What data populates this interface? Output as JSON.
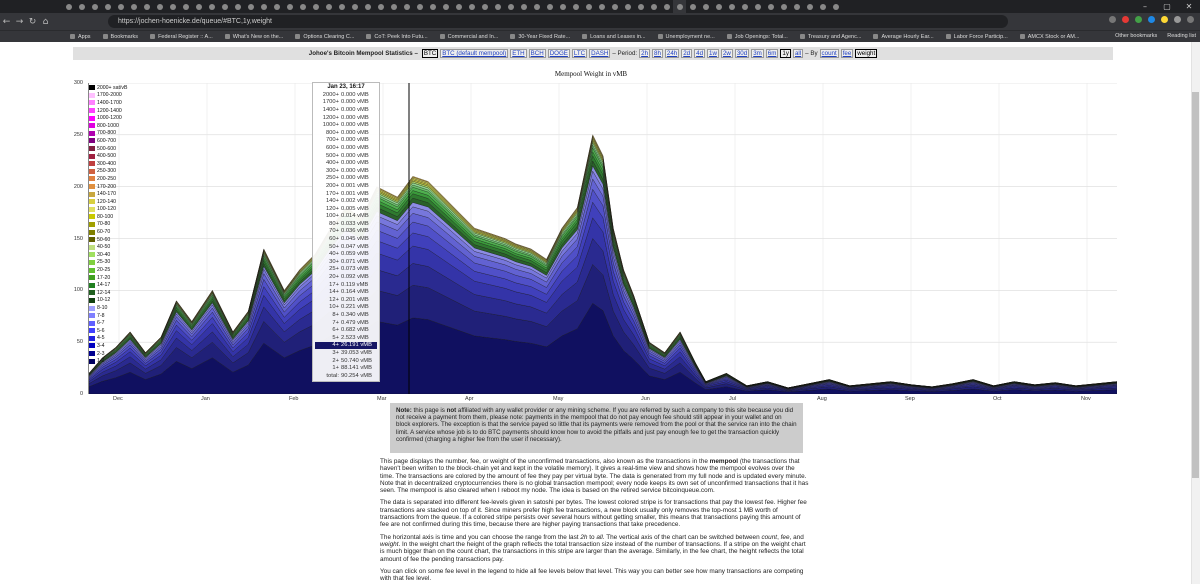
{
  "browser": {
    "url": "https://jochen-hoenicke.de/queue/#BTC,1y,weight",
    "window_controls": [
      "–",
      "▢",
      "✕"
    ],
    "tab_count": 60,
    "bookmarks": [
      {
        "label": "Apps"
      },
      {
        "label": "Bookmarks"
      },
      {
        "label": "Federal Register :: A..."
      },
      {
        "label": "What's New on the..."
      },
      {
        "label": "Options Clearing C..."
      },
      {
        "label": "CoT: Peek Into Futu..."
      },
      {
        "label": "Commercial and In..."
      },
      {
        "label": "30-Year Fixed Rate..."
      },
      {
        "label": "Loans and Leases in..."
      },
      {
        "label": "Unemployment ne..."
      },
      {
        "label": "Job Openings: Total..."
      },
      {
        "label": "Treasury and Agenc..."
      },
      {
        "label": "Average Hourly Ear..."
      },
      {
        "label": "Labor Force Particip..."
      },
      {
        "label": "AMCX Stock or AM..."
      }
    ],
    "bookmarks_right": [
      "Other bookmarks",
      "Reading list"
    ]
  },
  "header": {
    "title": "Johoe's Bitcoin Mempool Statistics –",
    "currencies": [
      {
        "label": "BTC",
        "selected": true
      },
      {
        "label": "BTC (default mempool)",
        "selected": false
      },
      {
        "label": "ETH",
        "selected": false
      },
      {
        "label": "BCH",
        "selected": false
      },
      {
        "label": "DOGE",
        "selected": false
      },
      {
        "label": "LTC",
        "selected": false
      },
      {
        "label": "DASH",
        "selected": false
      }
    ],
    "period_label": "– Period:",
    "periods": [
      {
        "label": "2h",
        "selected": false
      },
      {
        "label": "8h",
        "selected": false
      },
      {
        "label": "24h",
        "selected": false
      },
      {
        "label": "2d",
        "selected": false
      },
      {
        "label": "4d",
        "selected": false
      },
      {
        "label": "1w",
        "selected": false
      },
      {
        "label": "2w",
        "selected": false
      },
      {
        "label": "30d",
        "selected": false
      },
      {
        "label": "3m",
        "selected": false
      },
      {
        "label": "6m",
        "selected": false
      },
      {
        "label": "1y",
        "selected": true
      },
      {
        "label": "all",
        "selected": false
      }
    ],
    "by_label": "– By",
    "modes": [
      {
        "label": "count",
        "selected": false
      },
      {
        "label": "fee",
        "selected": false
      },
      {
        "label": "weight",
        "selected": true
      }
    ]
  },
  "chart_data": {
    "type": "area",
    "title": "Mempool Weight in vMB",
    "ylim": [
      0,
      300
    ],
    "yticks": [
      0,
      50,
      100,
      150,
      200,
      250,
      300
    ],
    "xticks": [
      "Dec",
      "Jan",
      "Feb",
      "Mar",
      "Apr",
      "May",
      "Jun",
      "Jul",
      "Aug",
      "Sep",
      "Oct",
      "Nov"
    ],
    "grid": true,
    "legend_position": "top-left",
    "series_order_bottom_to_top": [
      "1-2",
      "2-3",
      "3-4",
      "4-5",
      "5-6",
      "6-7",
      "7-8",
      "8-10",
      "10-12",
      "12-14",
      "14-17",
      "17-20",
      "20-25",
      "25-30",
      "30-40",
      "40-50",
      "50-60",
      "60-70",
      "70-80",
      "80-100",
      "100-120",
      "120-140",
      "140-170",
      "170-200",
      "200-250",
      "250-300",
      "300-400",
      "400-500",
      "500-600",
      "600-700",
      "700-800",
      "800-1000",
      "1000-1200",
      "1200-1400",
      "1400-1700",
      "1700-2000",
      "2000+ sat/vB"
    ],
    "legend": [
      {
        "label": "2000+ sat/vB",
        "color": "#000000"
      },
      {
        "label": "1700-2000",
        "color": "#ffc0ff"
      },
      {
        "label": "1400-1700",
        "color": "#ff80ff"
      },
      {
        "label": "1200-1400",
        "color": "#ff40ff"
      },
      {
        "label": "1000-1200",
        "color": "#ff00ff"
      },
      {
        "label": "800-1000",
        "color": "#e000e0"
      },
      {
        "label": "700-800",
        "color": "#b000b0"
      },
      {
        "label": "600-700",
        "color": "#800080"
      },
      {
        "label": "500-600",
        "color": "#802040"
      },
      {
        "label": "400-500",
        "color": "#a02040"
      },
      {
        "label": "300-400",
        "color": "#c04040"
      },
      {
        "label": "250-300",
        "color": "#d06040"
      },
      {
        "label": "200-250",
        "color": "#e08040"
      },
      {
        "label": "170-200",
        "color": "#e09040"
      },
      {
        "label": "140-170",
        "color": "#c8a840"
      },
      {
        "label": "120-140",
        "color": "#d8d040"
      },
      {
        "label": "100-120",
        "color": "#e0e060"
      },
      {
        "label": "80-100",
        "color": "#c8c800"
      },
      {
        "label": "70-80",
        "color": "#a0a000"
      },
      {
        "label": "60-70",
        "color": "#808000"
      },
      {
        "label": "50-60",
        "color": "#606000"
      },
      {
        "label": "40-50",
        "color": "#c0e080"
      },
      {
        "label": "30-40",
        "color": "#a0e060"
      },
      {
        "label": "25-30",
        "color": "#80d040"
      },
      {
        "label": "20-25",
        "color": "#60c030"
      },
      {
        "label": "17-20",
        "color": "#40a020"
      },
      {
        "label": "14-17",
        "color": "#208020"
      },
      {
        "label": "12-14",
        "color": "#206020"
      },
      {
        "label": "10-12",
        "color": "#104010"
      },
      {
        "label": "8-10",
        "color": "#a0a0ff"
      },
      {
        "label": "7-8",
        "color": "#8080ff"
      },
      {
        "label": "6-7",
        "color": "#6060ff"
      },
      {
        "label": "5-6",
        "color": "#4040ff"
      },
      {
        "label": "4-5",
        "color": "#2020e0"
      },
      {
        "label": "3-4",
        "color": "#0000c0"
      },
      {
        "label": "2-3",
        "color": "#000090"
      },
      {
        "label": "1-2",
        "color": "#000060"
      }
    ],
    "series_palette": [
      "#101060",
      "#202078",
      "#2a2a90",
      "#3434a8",
      "#4040bb",
      "#5050c8",
      "#6262d2",
      "#7777dc",
      "#8c8ce4",
      "#2a602a",
      "#2f7a2f",
      "#3a9a3a",
      "#4fb04f",
      "#6cc46c",
      "#8fd48f",
      "#a8d060",
      "#c0c040",
      "#d8d850",
      "#e8e070",
      "#d8b040"
    ],
    "series_x": [
      0.0,
      0.013,
      0.026,
      0.04,
      0.055,
      0.07,
      0.085,
      0.1,
      0.12,
      0.14,
      0.155,
      0.17,
      0.19,
      0.205,
      0.22,
      0.235,
      0.25,
      0.265,
      0.28,
      0.3,
      0.315,
      0.33,
      0.345,
      0.36,
      0.375,
      0.39,
      0.405,
      0.415,
      0.43,
      0.445,
      0.46,
      0.475,
      0.49,
      0.5,
      0.51,
      0.52,
      0.53,
      0.545,
      0.56,
      0.575,
      0.59,
      0.6,
      0.62,
      0.64,
      0.66,
      0.68,
      0.7,
      0.72,
      0.74,
      0.76,
      0.78,
      0.8,
      0.82,
      0.84,
      0.86,
      0.88,
      0.9,
      0.92,
      0.94,
      0.96,
      0.98,
      1.0
    ],
    "series_total_vmb": [
      20,
      35,
      45,
      60,
      40,
      55,
      90,
      70,
      100,
      60,
      80,
      140,
      100,
      120,
      135,
      160,
      180,
      170,
      200,
      190,
      210,
      205,
      190,
      175,
      160,
      155,
      150,
      145,
      140,
      130,
      160,
      180,
      250,
      230,
      160,
      120,
      95,
      50,
      40,
      60,
      30,
      12,
      20,
      8,
      12,
      6,
      10,
      14,
      8,
      10,
      12,
      9,
      7,
      10,
      14,
      8,
      12,
      9,
      11,
      8,
      10,
      12
    ],
    "tooltip": {
      "date": "Jan 23, 16:17",
      "selected": "4+",
      "rows": [
        {
          "k": "2000+",
          "v": "0.000 vMB"
        },
        {
          "k": "1700+",
          "v": "0.000 vMB"
        },
        {
          "k": "1400+",
          "v": "0.000 vMB"
        },
        {
          "k": "1200+",
          "v": "0.000 vMB"
        },
        {
          "k": "1000+",
          "v": "0.000 vMB"
        },
        {
          "k": "800+",
          "v": "0.000 vMB"
        },
        {
          "k": "700+",
          "v": "0.000 vMB"
        },
        {
          "k": "600+",
          "v": "0.000 vMB"
        },
        {
          "k": "500+",
          "v": "0.000 vMB"
        },
        {
          "k": "400+",
          "v": "0.000 vMB"
        },
        {
          "k": "300+",
          "v": "0.000 vMB"
        },
        {
          "k": "250+",
          "v": "0.000 vMB"
        },
        {
          "k": "200+",
          "v": "0.001 vMB"
        },
        {
          "k": "170+",
          "v": "0.001 vMB"
        },
        {
          "k": "140+",
          "v": "0.002 vMB"
        },
        {
          "k": "120+",
          "v": "0.005 vMB"
        },
        {
          "k": "100+",
          "v": "0.014 vMB"
        },
        {
          "k": "80+",
          "v": "0.033 vMB"
        },
        {
          "k": "70+",
          "v": "0.036 vMB"
        },
        {
          "k": "60+",
          "v": "0.045 vMB"
        },
        {
          "k": "50+",
          "v": "0.047 vMB"
        },
        {
          "k": "40+",
          "v": "0.059 vMB"
        },
        {
          "k": "30+",
          "v": "0.071 vMB"
        },
        {
          "k": "25+",
          "v": "0.073 vMB"
        },
        {
          "k": "20+",
          "v": "0.092 vMB"
        },
        {
          "k": "17+",
          "v": "0.119 vMB"
        },
        {
          "k": "14+",
          "v": "0.164 vMB"
        },
        {
          "k": "12+",
          "v": "0.201 vMB"
        },
        {
          "k": "10+",
          "v": "0.221 vMB"
        },
        {
          "k": "8+",
          "v": "0.340 vMB"
        },
        {
          "k": "7+",
          "v": "0.479 vMB"
        },
        {
          "k": "6+",
          "v": "0.682 vMB"
        },
        {
          "k": "5+",
          "v": "2.523 vMB"
        },
        {
          "k": "4+",
          "v": "26.191 vMB"
        },
        {
          "k": "3+",
          "v": "39.053 vMB"
        },
        {
          "k": "2+",
          "v": "50.740 vMB"
        },
        {
          "k": "1+",
          "v": "88.141 vMB"
        },
        {
          "k": "total:",
          "v": "90.254 vMB"
        }
      ]
    }
  },
  "note": {
    "prefix": "Note:",
    "text_a": " this page is ",
    "not": "not",
    "text_b": " affiliated with any wallet provider or any mining scheme. If you are referred by such a company to this site because you did not receive a payment from them, please note: payments in the mempool that do not pay enough fee should still appear in your wallet and on block explorers. The exception is that the service payed so little that its payments were removed from the pool or that the service ran into the chain limit. A service whose job is to do BTC payments should know how to avoid the pitfalls and just pay enough fee to get the transaction quickly confirmed (charging a higher fee from the user if necessary)."
  },
  "description": {
    "p1_a": "This page displays the number, fee, or weight of the unconfirmed transactions, also known as the transactions in the ",
    "p1_bold": "mempool",
    "p1_b": " (the transactions that haven't been written to the block-chain yet and kept in the volatile memory). It gives a real-time view and shows how the mempool evolves over the time. The transactions are colored by the amount of fee they pay per virtual byte. The data is generated from my full node and is updated every minute. Note that in decentralized cryptocurrencies there is no global transaction mempool; every node keeps its own set of unconfirmed transactions that it has seen. The mempool is also cleared when I reboot my node. The idea is based on the retired service bitcoinqueue.com.",
    "p2": "The data is separated into different fee-levels given in satoshi per bytes. The lowest colored stripe is for transactions that pay the lowest fee. Higher fee transactions are stacked on top of it. Since miners prefer high fee transactions, a new block usually only removes the top-most 1 MB worth of transactions from the queue. If a colored stripe persists over several hours without getting smaller, this means that transactions paying this amount of fee are not confirmed during this time, because there are higher paying transactions that take precedence.",
    "p3_a": "The horizontal axis is time and you can choose the range from the last ",
    "p3_2h": "2h",
    "p3_b": " to ",
    "p3_all": "all",
    "p3_c": ". The vertical axis of the chart can be switched between ",
    "p3_count": "count",
    "p3_d": ", ",
    "p3_fee": "fee",
    "p3_e": ", and ",
    "p3_weight": "weight",
    "p3_f": ". In the weight chart the height of the graph reflects the total transaction size instead of the number of transactions. If a stripe on the weight chart is much bigger than on the count chart, the transactions in this stripe are larger than the average. Similarly, in the fee chart, the height reflects the total amount of fee the pending transactions pay.",
    "p4": "You can click on some fee level in the legend to hide all fee levels below that level. This way you can better see how many transactions are competing with that fee level."
  }
}
